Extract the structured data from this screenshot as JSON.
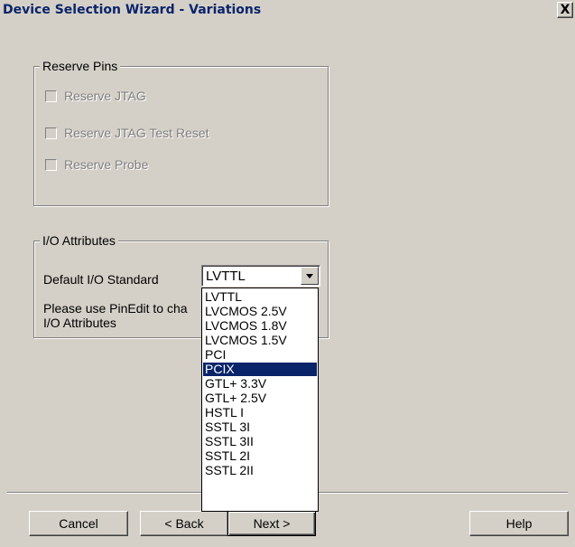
{
  "window": {
    "title": "Device Selection Wizard - Variations",
    "close_glyph": "X"
  },
  "reserve_pins": {
    "legend": "Reserve Pins",
    "options": [
      {
        "label": "Reserve JTAG",
        "checked": false,
        "enabled": false
      },
      {
        "label": "Reserve JTAG Test Reset",
        "checked": false,
        "enabled": false
      },
      {
        "label": "Reserve Probe",
        "checked": false,
        "enabled": false
      }
    ]
  },
  "io_attributes": {
    "legend": "I/O Attributes",
    "default_label": "Default I/O Standard",
    "selected_value": "LVTTL",
    "hint_line1": "Please use PinEdit to cha",
    "hint_line2": "I/O Attributes"
  },
  "dropdown": {
    "options": [
      "LVTTL",
      "LVCMOS 2.5V",
      "LVCMOS 1.8V",
      "LVCMOS 1.5V",
      "PCI",
      "PCIX",
      "GTL+ 3.3V",
      "GTL+ 2.5V",
      "HSTL I",
      "SSTL 3I",
      "SSTL 3II",
      "SSTL 2I",
      "SSTL 2II"
    ],
    "highlighted": "PCIX"
  },
  "buttons": {
    "cancel": "Cancel",
    "back": "< Back",
    "next": "Next >",
    "help": "Help"
  },
  "colors": {
    "face": "#d4d0c8",
    "title_text": "#0a246a",
    "highlight": "#0a246a",
    "disabled_text": "#808080"
  }
}
